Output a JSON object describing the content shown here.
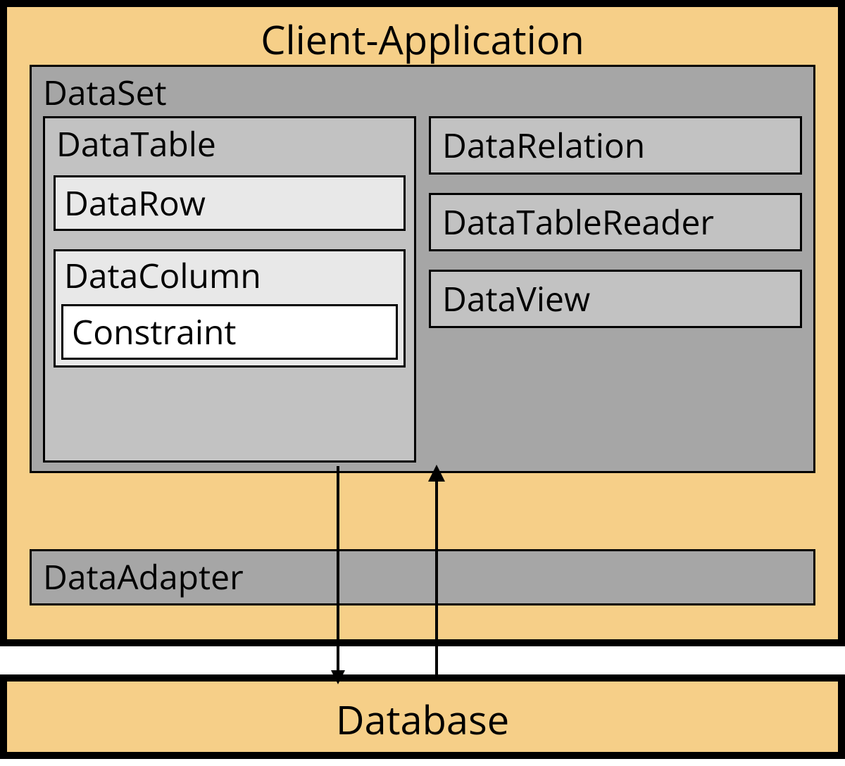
{
  "clientApp": {
    "title": "Client-Application"
  },
  "dataset": {
    "title": "DataSet",
    "dataTable": {
      "title": "DataTable",
      "dataRow": "DataRow",
      "dataColumn": {
        "title": "DataColumn",
        "constraint": "Constraint"
      }
    },
    "rightItems": {
      "dataRelation": "DataRelation",
      "dataTableReader": "DataTableReader",
      "dataView": "DataView"
    }
  },
  "dataAdapter": "DataAdapter",
  "database": "Database"
}
